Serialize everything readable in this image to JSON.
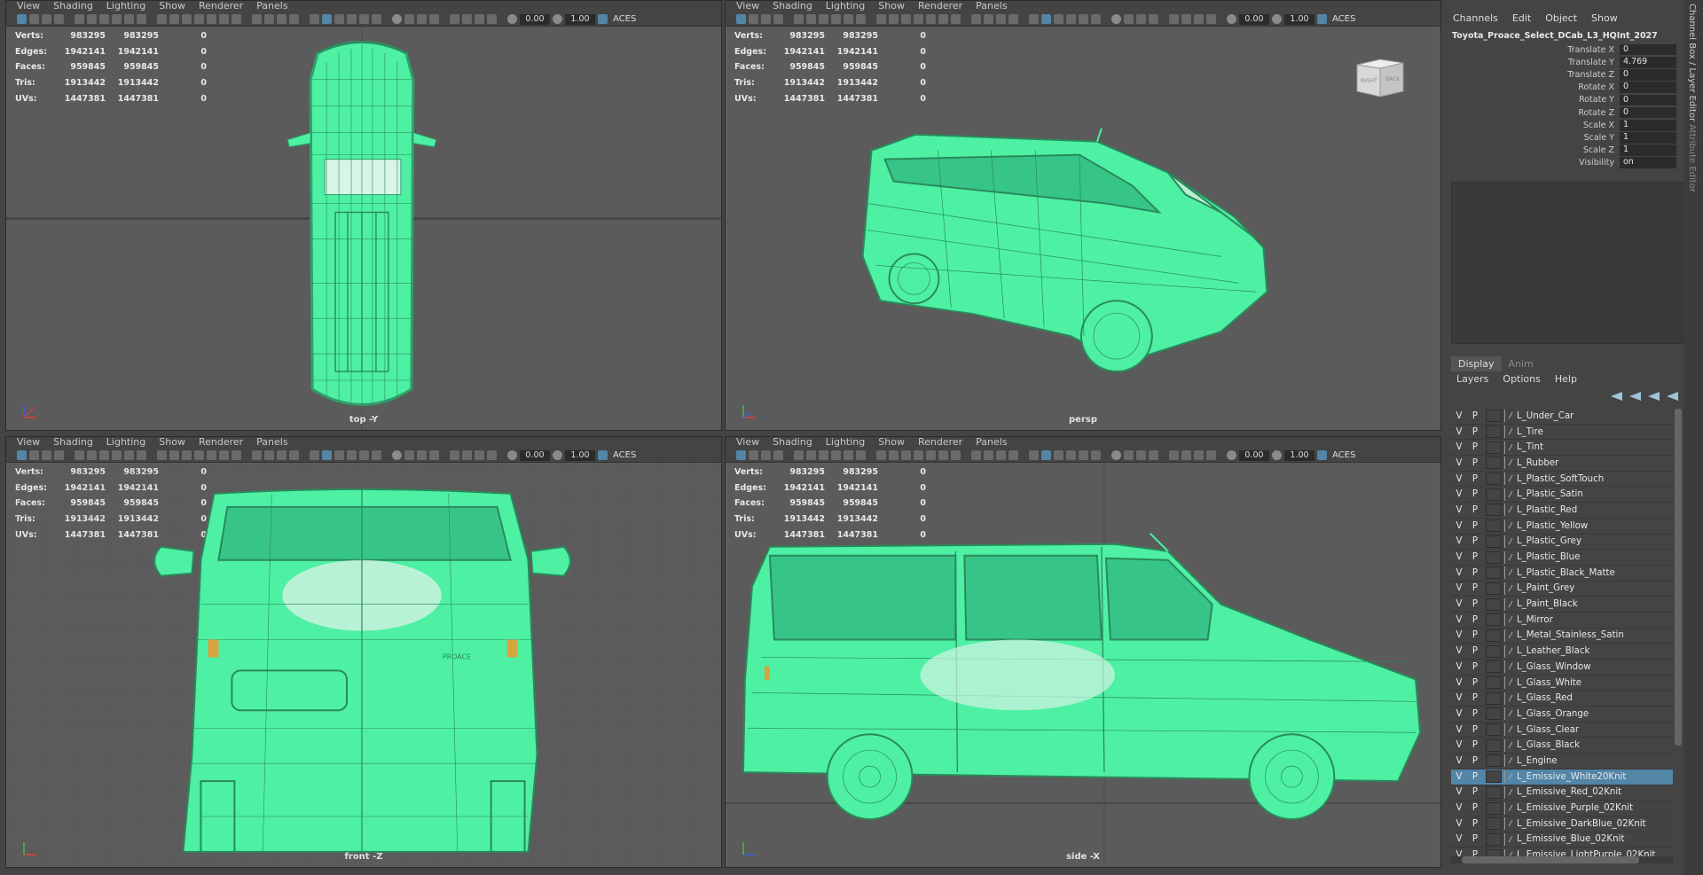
{
  "viewport_menu": [
    "View",
    "Shading",
    "Lighting",
    "Show",
    "Renderer",
    "Panels"
  ],
  "toolbar": {
    "field1": "0.00",
    "field2": "1.00",
    "color_space": "ACES"
  },
  "hud": {
    "rows": [
      {
        "label": "Verts:",
        "v1": "983295",
        "v2": "983295",
        "v3": "0"
      },
      {
        "label": "Edges:",
        "v1": "1942141",
        "v2": "1942141",
        "v3": "0"
      },
      {
        "label": "Faces:",
        "v1": "959845",
        "v2": "959845",
        "v3": "0"
      },
      {
        "label": "Tris:",
        "v1": "1913442",
        "v2": "1913442",
        "v3": "0"
      },
      {
        "label": "UVs:",
        "v1": "1447381",
        "v2": "1447381",
        "v3": "0"
      }
    ]
  },
  "viewports": {
    "top": {
      "camera": "top -Y"
    },
    "persp": {
      "camera": "persp",
      "viewcube_right": "RIGHT",
      "viewcube_back": "BACK"
    },
    "front": {
      "camera": "front -Z",
      "badge": "PROACE"
    },
    "side": {
      "camera": "side -X"
    }
  },
  "channel_box": {
    "menu": [
      "Channels",
      "Edit",
      "Object",
      "Show"
    ],
    "object_name": "Toyota_Proace_Select_DCab_L3_HQInt_2027",
    "attributes": [
      {
        "name": "Translate X",
        "value": "0"
      },
      {
        "name": "Translate Y",
        "value": "4.769"
      },
      {
        "name": "Translate Z",
        "value": "0"
      },
      {
        "name": "Rotate X",
        "value": "0"
      },
      {
        "name": "Rotate Y",
        "value": "0"
      },
      {
        "name": "Rotate Z",
        "value": "0"
      },
      {
        "name": "Scale X",
        "value": "1"
      },
      {
        "name": "Scale Y",
        "value": "1"
      },
      {
        "name": "Scale Z",
        "value": "1"
      },
      {
        "name": "Visibility",
        "value": "on"
      }
    ]
  },
  "layer_editor": {
    "tabs": [
      "Display",
      "Anim"
    ],
    "menu": [
      "Layers",
      "Options",
      "Help"
    ],
    "v_label": "V",
    "p_label": "P",
    "layers": [
      "L_Under_Car",
      "L_Tire",
      "L_Tint",
      "L_Rubber",
      "L_Plastic_SoftTouch",
      "L_Plastic_Satin",
      "L_Plastic_Red",
      "L_Plastic_Yellow",
      "L_Plastic_Grey",
      "L_Plastic_Blue",
      "L_Plastic_Black_Matte",
      "L_Paint_Grey",
      "L_Paint_Black",
      "L_Mirror",
      "L_Metal_Stainless_Satin",
      "L_Leather_Black",
      "L_Glass_Window",
      "L_Glass_White",
      "L_Glass_Red",
      "L_Glass_Orange",
      "L_Glass_Clear",
      "L_Glass_Black",
      "L_Engine",
      "L_Emissive_White20Knit",
      "L_Emissive_Red_02Knit",
      "L_Emissive_Purple_02Knit",
      "L_Emissive_DarkBlue_02Knit",
      "L_Emissive_Blue_02Knit",
      "L_Emissive_LightPurple_02Knit"
    ],
    "selected_layer": "L_Emissive_White20Knit"
  },
  "side_tabs": [
    "Channel Box / Layer Editor",
    "Attribute Editor"
  ],
  "colors": {
    "wireframe": "#4ef0a4",
    "viewport_bg": "#5b5b5b",
    "ui_bg": "#444444",
    "selection": "#5285a6"
  }
}
